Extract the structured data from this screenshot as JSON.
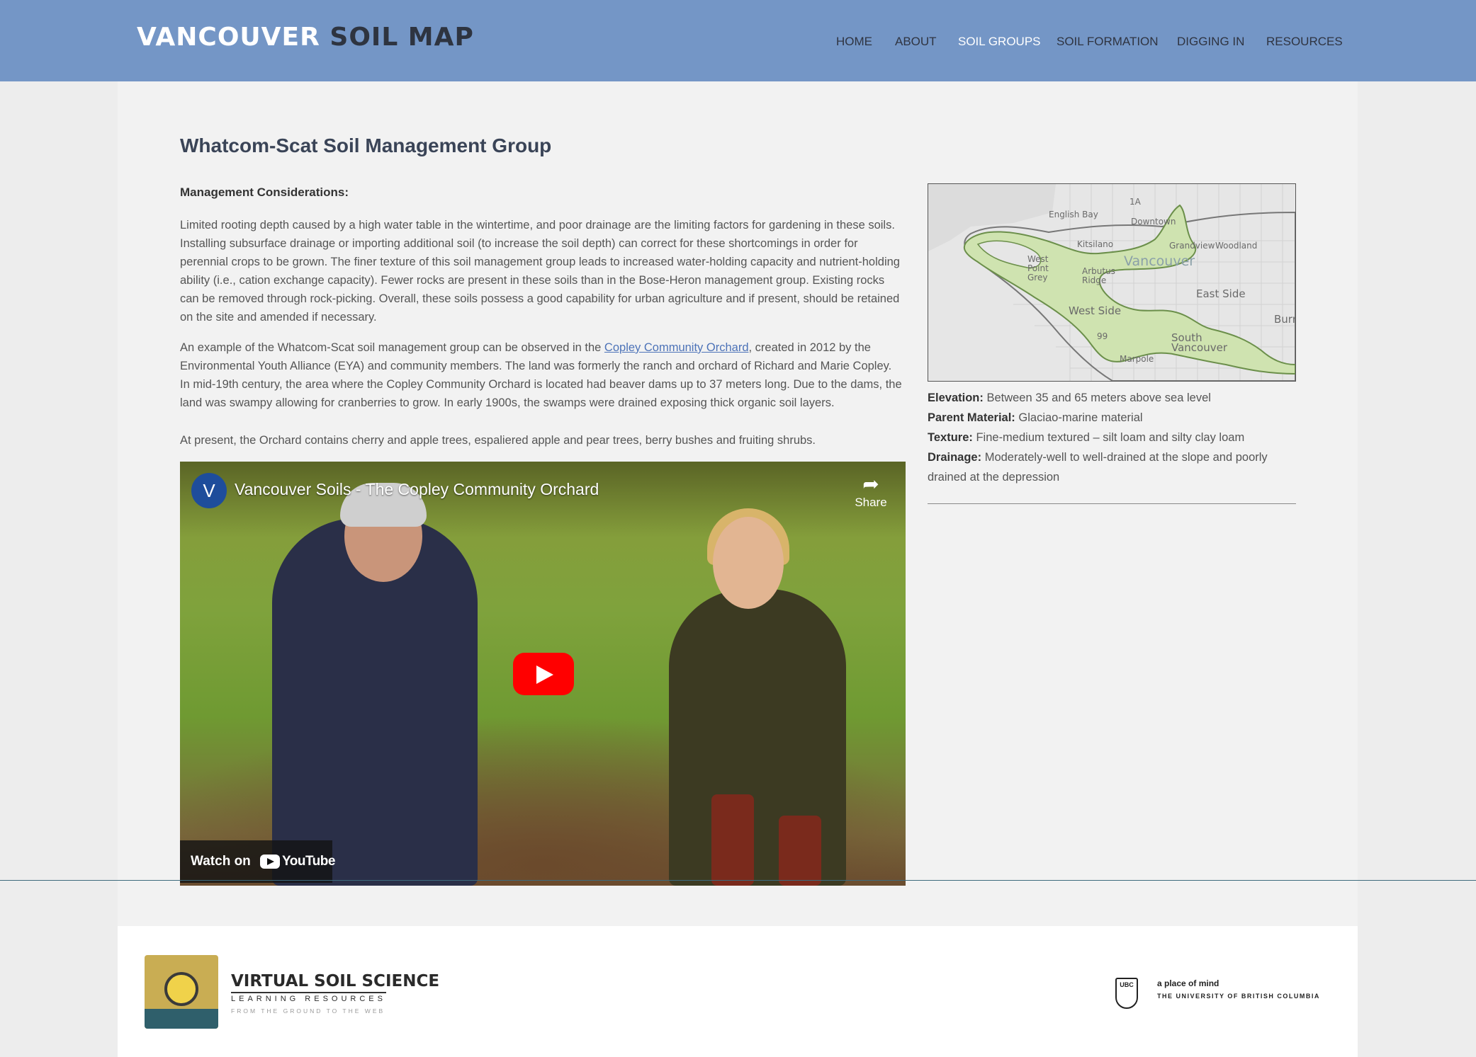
{
  "header": {
    "logo_part1": "VANCOUVER",
    "logo_part2": "SOIL MAP",
    "nav": [
      "HOME",
      "ABOUT",
      "SOIL GROUPS",
      "SOIL FORMATION",
      "DIGGING IN",
      "RESOURCES"
    ],
    "active_nav": "SOIL GROUPS"
  },
  "page": {
    "title": "Whatcom-Scat Soil Management Group",
    "management_heading": "Management Considerations:",
    "paragraph1": "Limited rooting depth caused by a high water table in the wintertime, and poor drainage are the limiting factors for gardening in these soils. Installing subsurface drainage or importing additional soil (to increase the soil depth) can correct for these shortcomings in order for perennial crops to be grown. The finer texture of this soil management group leads to increased water-holding capacity and nutrient-holding ability (i.e., cation exchange capacity). Fewer rocks are present in these soils than in the Bose-Heron management group. Existing rocks can be removed through rock-picking. Overall, these soils possess a good capability for urban agriculture and if present, should be retained on the site and amended if necessary.",
    "paragraph2_before_link": "An example of the Whatcom-Scat soil management group can be observed in the ",
    "paragraph2_link": "Copley Community Orchard",
    "paragraph2_after_link": ", created in 2012 by the Environmental Youth Alliance (EYA) and community members. The land was formerly the ranch and orchard of Richard and Marie Copley. In mid-19th century, the area where the Copley Community Orchard is located had beaver dams up to 37 meters long. Due to the dams, the land was swampy allowing for cranberries to grow. In early 1900s, the swamps were drained exposing thick organic soil layers.",
    "paragraph3": "At present, the Orchard contains cherry and apple trees, espaliered apple and pear trees, berry bushes and fruiting shrubs."
  },
  "video": {
    "channel_initial": "V",
    "title": "Vancouver Soils - The Copley Community Orchard",
    "share_label": "Share",
    "share_icon": "share-arrow-icon",
    "play_icon": "play-icon",
    "watch_on": "Watch on",
    "youtube_label": "YouTube"
  },
  "map": {
    "labels": [
      "English Bay",
      "Downtown",
      "Kitsilano",
      "Grandview",
      "Woodland",
      "Vancouver",
      "West Point Grey",
      "Arbutus Ridge",
      "East Side",
      "West Side",
      "Burr",
      "South Vancouver",
      "Marpole",
      "1A",
      "99"
    ]
  },
  "soil_properties": {
    "elevation_label": "Elevation:",
    "elevation": "Between 35 and 65 meters above sea level",
    "parent_material_label": "Parent Material:",
    "parent_material": "Glaciao-marine material",
    "texture_label": "Texture:",
    "texture": "Fine-medium textured – silt loam and silty clay loam",
    "drainage_label": "Drainage:",
    "drainage": "Moderately-well to well-drained at the slope and poorly drained at the depression"
  },
  "footer": {
    "vss_title": "VIRTUAL SOIL SCIENCE",
    "vss_subtitle": "LEARNING RESOURCES",
    "vss_tagline": "FROM THE GROUND TO THE WEB",
    "ubc_crest": "UBC",
    "ubc_tagline": "a place of mind",
    "ubc_name": "THE UNIVERSITY OF BRITISH COLUMBIA"
  },
  "colors": {
    "header_bg": "#7496c6",
    "panel_bg": "#f2f2f2",
    "title": "#3a4457",
    "link": "#4d73b8",
    "youtube_red": "#ff0000",
    "soil_zone": "#cfe3b0"
  }
}
